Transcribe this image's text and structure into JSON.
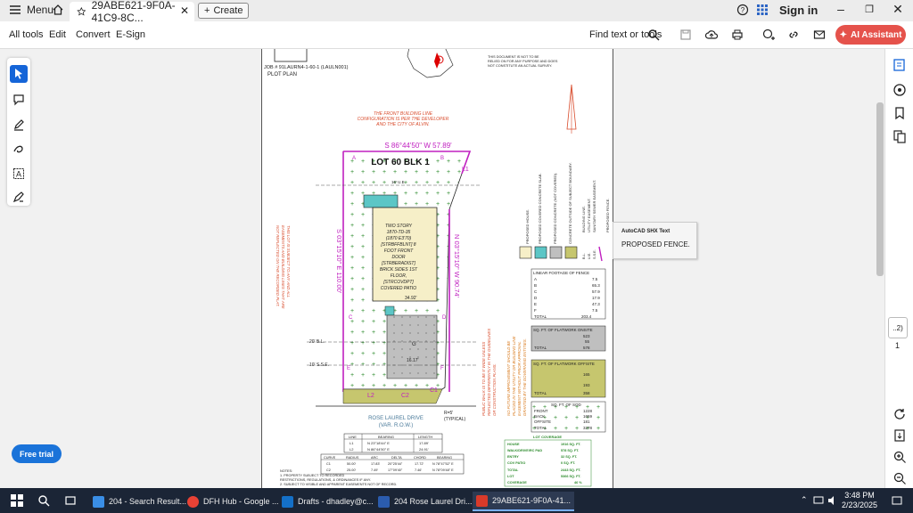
{
  "titlebar": {
    "menu_label": "Menu",
    "tab_title": "29ABE621-9F0A-41C9-8C...",
    "create_label": "Create",
    "signin_label": "Sign in"
  },
  "toolbar": {
    "all_tools": "All tools",
    "edit": "Edit",
    "convert": "Convert",
    "esign": "E-Sign",
    "find_text": "Find text or tools",
    "ai_assistant": "AI Assistant"
  },
  "free_trial": "Free trial",
  "tooltip": {
    "title": "AutoCAD SHX Text",
    "body": "PROPOSED FENCE."
  },
  "page_nav": {
    "current": "..2)",
    "total": "1"
  },
  "plot": {
    "job": "JOB #  91LAURN4-1-60-1 (LAULN001)",
    "plan": "PLOT PLAN",
    "disclaimer": [
      "THIS DOCUMENT IS NOT TO BE",
      "RELIED ON FOR ANY PURPOSE AND DOES",
      "NOT CONSTITUTE AN ACTUAL SURVEY."
    ],
    "header_note": [
      "THE FRONT BUILDING LINE",
      "CONFIGURATION IS PER THE DEVELOPER",
      "AND THE CITY OF ALVIN."
    ],
    "bearing_top": "S 86°44'50\" W 57.89'",
    "lot": "LOT 60  BLK 1",
    "house": [
      "TWO STORY",
      "1870-TD-35",
      "(1870 E3'70)",
      "[STRBFFBLNT] 8",
      "FOOT FRONT",
      "DOOR",
      "[STRBERADIST]",
      "BRICK SIDES 1ST",
      "FLOOR,",
      "[STRCOVDPT]",
      "COVERED PATIO"
    ],
    "bearing_left": "S 03°15'10\" E 110.00'",
    "bearing_right": "N 03°15'10\" W 90.74'",
    "street": [
      "ROSE LAUREL DRIVE",
      "(VAR. R.O.W.)"
    ],
    "radius": [
      "R=5'",
      "(TYPICAL)"
    ],
    "left_note": [
      "THIS LOT IS SUBJECT TO ANY AND ALL",
      "EASEMENTS AND BUILDING LINES THAT ARE",
      "NOT REFLECTED ON THE RECORDED PLAT."
    ],
    "sidewalk_note": [
      "PUBLIC WALK IS TO BE 5' WIDE UNLESS",
      "REFLECTED DIFFERENTLY IN THE GUIDELINES",
      "OR CONSTRUCTION PLANS."
    ],
    "improvement_note": [
      "NO FUTURE IMPROVEMENT SHOULD BE",
      "PLACED IN THE UTILITY OR BUILDING LINE",
      "EASEMENT WITHOUT PRIOR APPROVAL",
      "GRANTED BY THE GOVERNING ENTITIES."
    ],
    "legend": [
      "PROPOSED HOUSE.",
      "PROPOSED COVERED CONCRETE SLAB.",
      "PROPOSED CONCRETE (NOT COVERED).",
      "CONCRETE OUTSIDE OF SUBJECT BOUNDARY.",
      "BUILDING LINE.",
      "UTILITY EASEMENT.",
      "SANITARY SEWER EASEMENT.",
      "PROPOSED FENCE."
    ],
    "legend_abbr": [
      "B.L.",
      "U.E.",
      "S.S.E."
    ],
    "fence_table": {
      "title": "LINEAR FOOTAGE OF FENCE",
      "rows": [
        [
          "A",
          "7.5"
        ],
        [
          "B",
          "65.3"
        ],
        [
          "C",
          "57.9"
        ],
        [
          "D",
          "17.9"
        ],
        [
          "E",
          "47.3"
        ],
        [
          "F",
          "7.5"
        ],
        [
          "TOTAL",
          "203.4"
        ]
      ]
    },
    "flatwork_onsite": {
      "title": "SQ. FT. OF FLATWORK ONSITE",
      "rows": [
        [
          "",
          "523"
        ],
        [
          "",
          "55"
        ],
        [
          "TOTAL",
          "578"
        ]
      ]
    },
    "flatwork_offsite": {
      "title": "SQ. FT. OF FLATWORK OFFSITE",
      "rows": [
        [
          "",
          "165"
        ],
        [
          "",
          "193"
        ],
        [
          "TOTAL",
          "358"
        ]
      ]
    },
    "sod_table": {
      "title": "SQ. FT. OF SOD",
      "rows": [
        [
          "FRONT",
          "1228"
        ],
        [
          "BACK",
          "1659"
        ],
        [
          "OFFSITE",
          "181"
        ],
        [
          "TOTAL",
          "3278"
        ]
      ]
    },
    "lot_coverage": {
      "title": "LOT COVERAGE",
      "rows": [
        [
          "HOUSE",
          "1916 SQ. FT."
        ],
        [
          "WALK/DRIVE/RC PAD",
          "578 SQ. FT."
        ],
        [
          "ENTRY",
          "32 SQ. FT."
        ],
        [
          "COV PATIO",
          "0 SQ. FT."
        ],
        [
          "TOTAL",
          "2443 SQ. FT."
        ],
        [
          "LOT",
          "5366 SQ. FT."
        ],
        [
          "COVERAGE",
          "46 %"
        ]
      ]
    },
    "bearing_table": {
      "headers": [
        "LINE",
        "BEARING",
        "LENGTH"
      ],
      "rows": [
        [
          "L1",
          "N 23°18'44\" E",
          "17.89'"
        ],
        [
          "L2",
          "N 86°44'50\" E",
          "24.91'"
        ]
      ]
    },
    "curve_table": {
      "headers": [
        "CURVE",
        "RADIUS",
        "ARC",
        "DELTA",
        "CHORD",
        "BEARING"
      ],
      "rows": [
        [
          "C1",
          "50.00'",
          "17.83'",
          "20°25'44\"",
          "17.72'",
          "N 78°47'52\" E"
        ],
        [
          "C2",
          "25.00'",
          "7.49'",
          "17°09'40\"",
          "7.46'",
          "N 78°09'48\" E"
        ]
      ]
    },
    "notes": [
      "NOTES:",
      "1. PROPERTY SUBJECT TO RECORDED",
      "RESTRICTIONS, REGULATIONS, & ORDINANCES IF ANY.",
      "2. SUBJECT TO VISIBLE AND APPARENT EASEMENTS NOT OF RECORD."
    ],
    "dims": {
      "ue": "16' U.E.",
      "bl20": "20' B.L.",
      "sse10": "10' S.S.E.",
      "w3492": "34.92'",
      "w1617": "16.17'",
      "g": "G"
    },
    "letters": [
      "A",
      "B",
      "C",
      "D",
      "E",
      "F"
    ],
    "line_labels": [
      "L1",
      "L2",
      "C1",
      "C2"
    ]
  },
  "taskbar": {
    "apps": [
      "204 - Search Result...",
      "DFH Hub - Google ...",
      "Drafts - dhadley@c...",
      "204 Rose Laurel Dri...",
      "29ABE621-9F0A-41..."
    ],
    "time": "3:48 PM",
    "date": "2/23/2025"
  },
  "colors": {
    "accent_blue": "#1565d8",
    "ai_red": "#e5524b",
    "fence_magenta": "#c020c0",
    "house_fill": "#f6efc8",
    "covered_slab": "#5cc6c6",
    "concrete": "#bfbfbf",
    "offsite": "#c6c66e",
    "annotation_red": "#d84a2a"
  }
}
